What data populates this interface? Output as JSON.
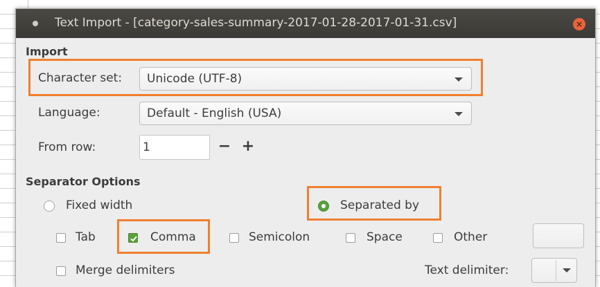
{
  "window": {
    "title": "Text Import - [category-sales-summary-2017-01-28-2017-01-31.csv]",
    "close_glyph": "×"
  },
  "import": {
    "section_label": "Import",
    "character_set_label": "Character set:",
    "character_set_value": "Unicode (UTF-8)",
    "language_label": "Language:",
    "language_value": "Default - English (USA)",
    "from_row_label": "From row:",
    "from_row_value": "1",
    "minus": "−",
    "plus": "+"
  },
  "separator": {
    "section_label": "Separator Options",
    "fixed_width_label": "Fixed width",
    "fixed_width_selected": false,
    "separated_by_label": "Separated by",
    "separated_by_selected": true,
    "options": [
      {
        "label": "Tab",
        "checked": false
      },
      {
        "label": "Comma",
        "checked": true
      },
      {
        "label": "Semicolon",
        "checked": false
      },
      {
        "label": "Space",
        "checked": false
      },
      {
        "label": "Other",
        "checked": false
      }
    ],
    "other_value": "",
    "merge_delimiters_label": "Merge delimiters",
    "merge_delimiters_checked": false,
    "text_delimiter_label": "Text delimiter:",
    "text_delimiter_value": ""
  },
  "colors": {
    "highlight": "#f07f2e",
    "accent_green": "#5aa03b",
    "titlebar": "#3b3a36",
    "close_button": "#e9643a"
  }
}
